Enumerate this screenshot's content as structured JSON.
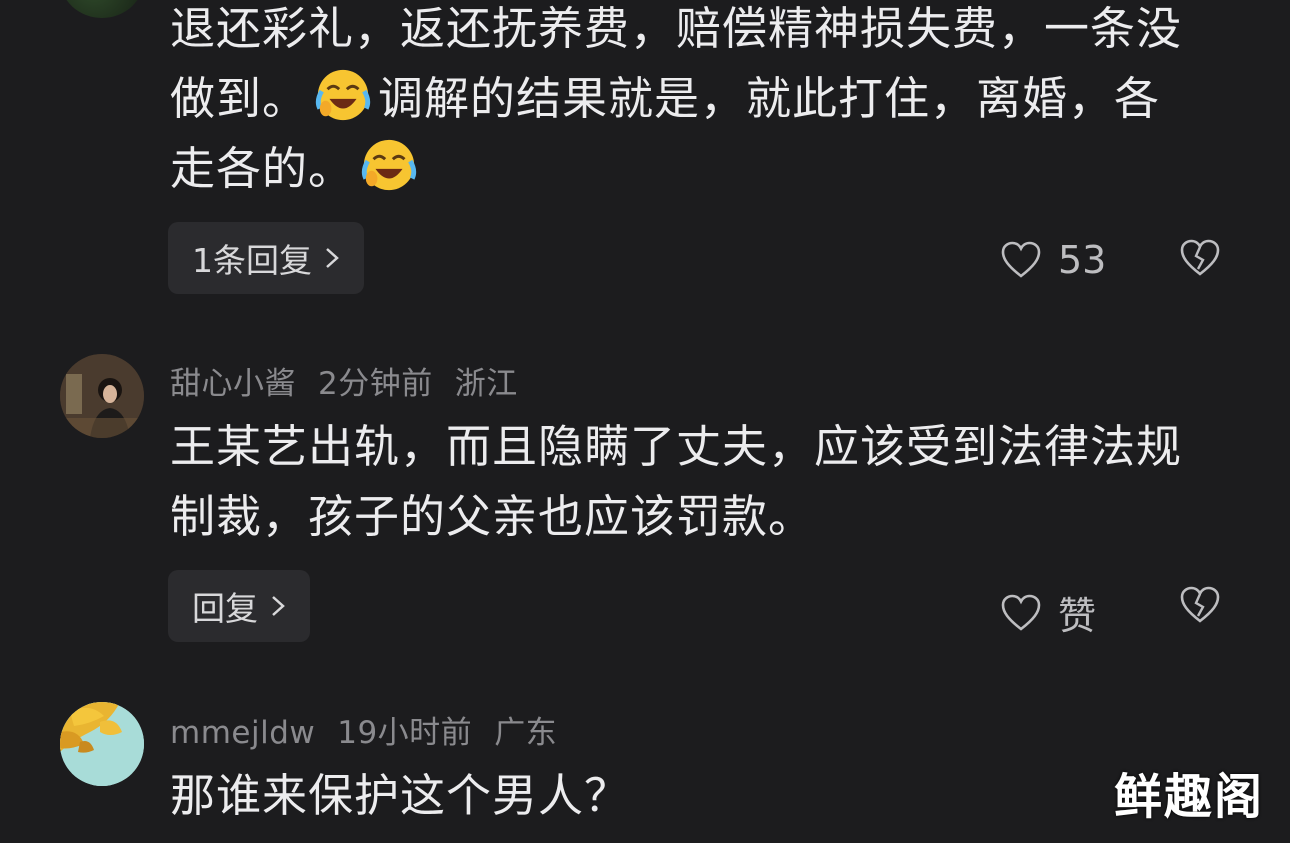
{
  "comments": [
    {
      "body_lines": [
        "退还彩礼，返还抚养费，赔偿精神损失费，一条没",
        "做到。",
        "调解的结果就是，就此打住，离婚，各",
        "走各的。"
      ],
      "reply_label": "1条回复",
      "like_count": "53"
    },
    {
      "username": "甜心小酱",
      "time": "2分钟前",
      "location": "浙江",
      "body_lines": [
        "王某艺出轨，而且隐瞒了丈夫，应该受到法律法规",
        "制裁，孩子的父亲也应该罚款。"
      ],
      "reply_label": "回复",
      "like_label": "赞"
    },
    {
      "username": "mmejldw",
      "time": "19小时前",
      "location": "广东",
      "body_lines": [
        "那谁来保护这个男人？"
      ]
    }
  ],
  "emoji": "laughing-crying-emoji",
  "icons": {
    "like": "heart-icon",
    "dislike": "broken-heart-icon",
    "chevron": "chevron-right-icon"
  },
  "watermark": "鲜趣阁",
  "colors": {
    "background": "#1c1c1e",
    "text": "#ececee",
    "meta": "#8a8a8e",
    "button_bg": "#2b2b2e"
  }
}
